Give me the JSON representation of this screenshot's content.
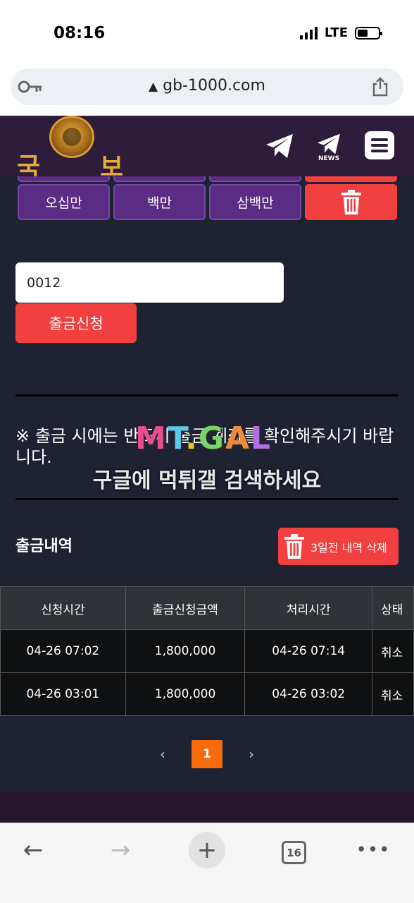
{
  "status_bar": {
    "time": "08:16",
    "network": "LTE"
  },
  "browser": {
    "url": "gb-1000.com"
  },
  "header": {
    "logo_left": "국",
    "logo_right": "보",
    "news_label": "NEWS"
  },
  "amount_buttons": [
    {
      "label": "오십만"
    },
    {
      "label": "백만"
    },
    {
      "label": "삼백만"
    }
  ],
  "withdraw_form": {
    "input_value": "0012",
    "submit_label": "출금신청"
  },
  "notice": {
    "text": "※ 출금 시에는 반드시 출금 계좌를 확인해주시기 바랍니다."
  },
  "watermark": {
    "logo": "MT.GAL",
    "text": "구글에 먹튀갤 검색하세요"
  },
  "history": {
    "title": "출금내역",
    "delete_label": "3일전 내역 삭제",
    "columns": [
      "신청시간",
      "출금신청금액",
      "처리시간",
      "상태"
    ],
    "rows": [
      {
        "requested": "04-26 07:02",
        "amount": "1,800,000",
        "processed": "04-26 07:14",
        "status": "취소"
      },
      {
        "requested": "04-26 03:01",
        "amount": "1,800,000",
        "processed": "04-26 03:02",
        "status": "취소"
      }
    ]
  },
  "pagination": {
    "prev": "‹",
    "current": "1",
    "next": "›"
  },
  "toolbar": {
    "back": "←",
    "forward": "→",
    "new_tab": "+",
    "tab_count": "16",
    "more": "•••"
  },
  "colors": {
    "background": "#1e2233",
    "header": "#2e1d3a",
    "amount_button": "#5b2c83",
    "danger": "#f24040",
    "page_active": "#f76b0a",
    "logo_gold": "#e6a93a"
  }
}
